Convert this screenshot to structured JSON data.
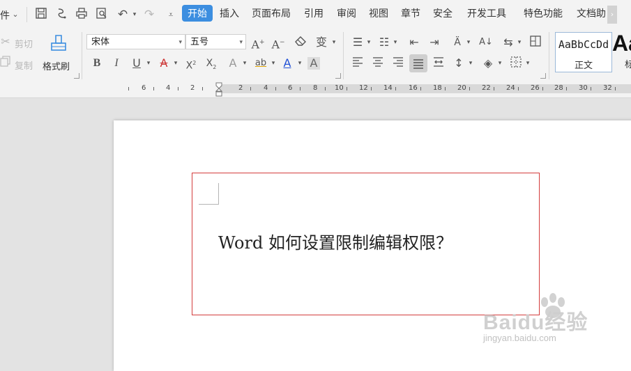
{
  "topbar": {
    "menu_prefix": "件",
    "tabs": [
      {
        "label": "开始",
        "active": true
      },
      {
        "label": "插入"
      },
      {
        "label": "页面布局"
      },
      {
        "label": "引用"
      },
      {
        "label": "审阅"
      },
      {
        "label": "视图"
      },
      {
        "label": "章节"
      },
      {
        "label": "安全"
      },
      {
        "label": "开发工具"
      },
      {
        "label": "特色功能"
      },
      {
        "label": "文档助"
      }
    ],
    "accent": "#3c8ee0"
  },
  "ribbon": {
    "clipboard": {
      "cut_label": "剪切",
      "copy_label": "复制",
      "format_painter_label": "格式刷"
    },
    "font": {
      "family": "宋体",
      "size": "五号",
      "phonetic_glyph": "变",
      "highlight_glyph": "ab",
      "font_color_glyph": "A",
      "char_shading_glyph": "A"
    },
    "styles": {
      "sample_text": "AaBbCcDd",
      "normal_label": "正文",
      "big_sample": "Aa",
      "big_label": "标"
    }
  },
  "ruler": {
    "labels": [
      "6",
      "4",
      "2",
      "2",
      "4",
      "6",
      "8",
      "10",
      "12",
      "14",
      "16",
      "18",
      "20",
      "22",
      "24",
      "26",
      "28",
      "30",
      "32"
    ]
  },
  "document": {
    "text": "Word 如何设置限制编辑权限？",
    "frame_color": "#d33c3c"
  },
  "watermark": {
    "brand": "Baidu经验",
    "url": "jingyan.baidu.com"
  }
}
